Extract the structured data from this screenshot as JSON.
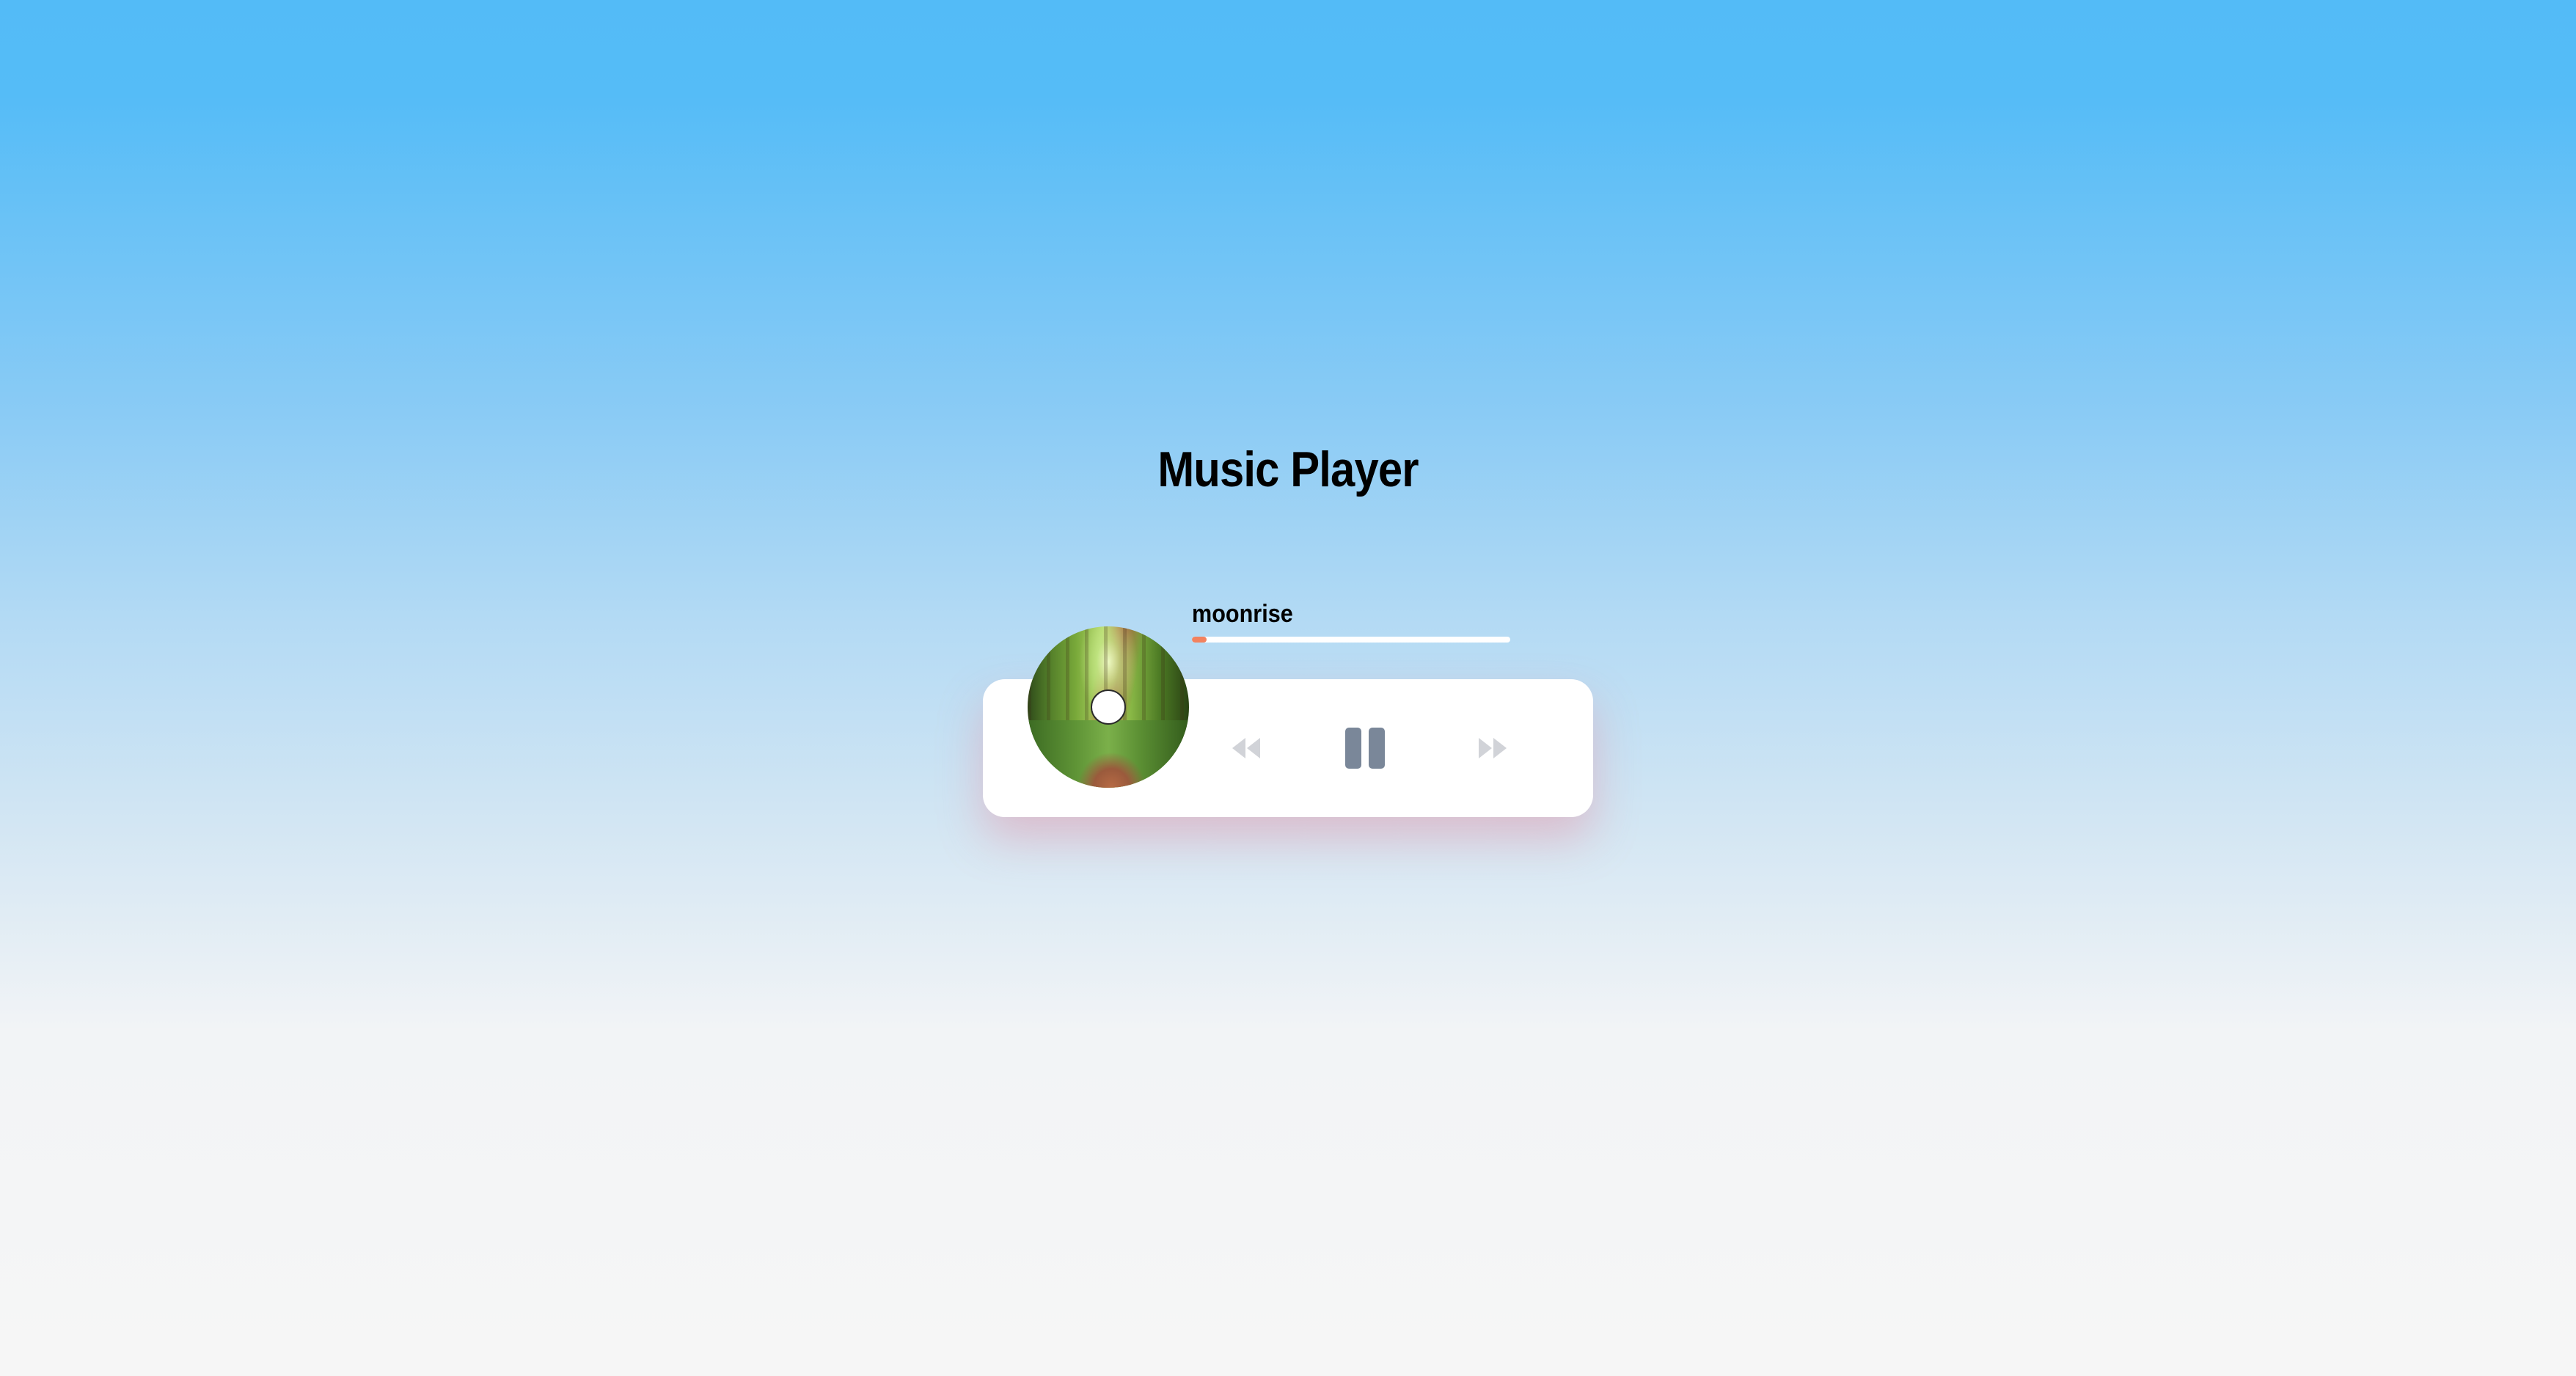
{
  "app": {
    "title": "Music Player"
  },
  "track": {
    "title": "moonrise",
    "progress_percent": 4.5
  },
  "controls": {
    "prev_icon": "backward-icon",
    "play_icon": "pause-icon",
    "next_icon": "forward-icon"
  },
  "colors": {
    "progress_fill": "#f2825f",
    "progress_track": "#ffffff",
    "pause_icon": "#7a8799",
    "skip_icons": "#d1d3d8"
  }
}
